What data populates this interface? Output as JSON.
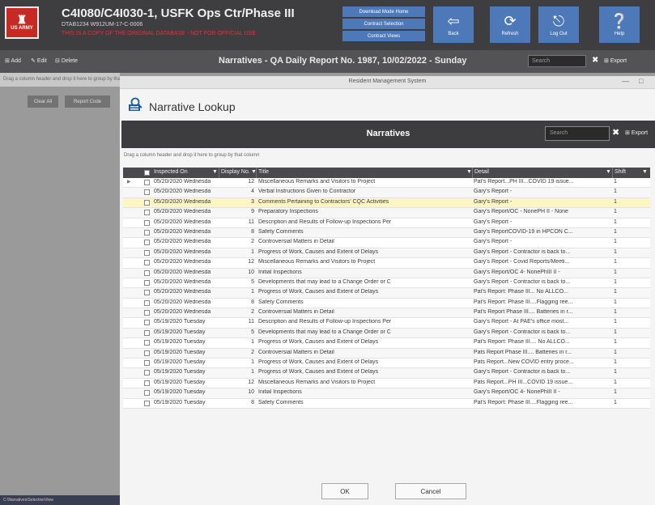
{
  "app": {
    "logo_text": "US ARMY",
    "project_title": "C4I080/C4I030-1, USFK Ops Ctr/Phase III",
    "project_subtitle": "DTAB1234 W912UM-17-C-0006",
    "project_note": "THIS IS A COPY OF THE ORIGINAL DATABASE - NOT FOR OFFICIAL USE",
    "stack_buttons": [
      "Download Mode Home",
      "Contract Selection",
      "Contract Views"
    ],
    "buttons": [
      {
        "label": "Back",
        "icon": "back-arrow-icon"
      },
      {
        "label": "Refresh",
        "icon": "refresh-icon"
      },
      {
        "label": "Log Out",
        "icon": "logout-icon"
      },
      {
        "label": "Help",
        "icon": "help-icon"
      }
    ]
  },
  "toolbar": {
    "add_label": "Add",
    "edit_label": "Edit",
    "delete_label": "Delete",
    "title": "Narratives - QA Daily Report No. 1987, 10/02/2022 - Sunday",
    "search_placeholder": "Search",
    "export_label": "Export"
  },
  "background": {
    "group_hint": "Drag a column header and drop it here to group by that column",
    "btn1": "Clear All",
    "btn2": "Report Code",
    "status": "C:\\Narratives\\SelectionView"
  },
  "dialog": {
    "window_title": "Resident Management System",
    "heading": "Narrative Lookup",
    "panel_title": "Narratives",
    "search_placeholder": "Search",
    "export_label": "Export",
    "group_hint": "Drag a column header and drop it here to group by that column",
    "columns": {
      "date": "Inspected On",
      "no": "Display No.",
      "title": "Title",
      "detail": "Detail",
      "shift": "Shift"
    },
    "rows": [
      {
        "date": "05/20/2020 Wednesda",
        "no": "12",
        "title": "Miscellaneous Remarks and Visitors to Project",
        "detail": "Pat's Report...PH III...COVID 19 issue...",
        "shift": "1"
      },
      {
        "date": "05/20/2020 Wednesda",
        "no": "4",
        "title": "Verbal Instructions Given to Contractor",
        "detail": "Gary's Report -",
        "shift": "1"
      },
      {
        "date": "05/20/2020 Wednesda",
        "no": "3",
        "title": "Comments Pertaining to Contractors' CQC Activities",
        "detail": "Gary's Report -",
        "shift": "1"
      },
      {
        "date": "05/20/2020 Wednesda",
        "no": "9",
        "title": "Preparatory Inspections",
        "detail": "Gary's Report/OC - NonePH II - None",
        "shift": "1"
      },
      {
        "date": "05/20/2020 Wednesda",
        "no": "11",
        "title": "Description and Results of Follow-up Inspections Per",
        "detail": "Gary's Report -",
        "shift": "1"
      },
      {
        "date": "05/20/2020 Wednesda",
        "no": "8",
        "title": "Safety Comments",
        "detail": "Gary's ReportCOVID-19 in HPCON C...",
        "shift": "1"
      },
      {
        "date": "05/20/2020 Wednesda",
        "no": "2",
        "title": "Controversial Matters in Detail",
        "detail": "Gary's Report -",
        "shift": "1"
      },
      {
        "date": "05/20/2020 Wednesda",
        "no": "1",
        "title": "Progress of Work, Causes and Extent of Delays",
        "detail": "Gary's Report - Contractor is back to...",
        "shift": "1"
      },
      {
        "date": "05/20/2020 Wednesda",
        "no": "12",
        "title": "Miscellaneous Remarks and Visitors to Project",
        "detail": "Gary's Report - Covid Reports/Meeti...",
        "shift": "1"
      },
      {
        "date": "05/20/2020 Wednesda",
        "no": "10",
        "title": "Initial Inspections",
        "detail": "Gary's Report/OC 4- NonePhIII II -",
        "shift": "1"
      },
      {
        "date": "05/20/2020 Wednesda",
        "no": "5",
        "title": "Developments that may lead to a Change Order or C",
        "detail": "Gary's Report - Contractor is back to...",
        "shift": "1"
      },
      {
        "date": "05/20/2020 Wednesda",
        "no": "1",
        "title": "Progress of Work, Causes and Extent of Delays",
        "detail": "Pat's Report: Phase III... No ALLCO...",
        "shift": "1"
      },
      {
        "date": "05/20/2020 Wednesda",
        "no": "8",
        "title": "Safety Comments",
        "detail": "Pat's Report: Phase III....Flagging ree...",
        "shift": "1"
      },
      {
        "date": "05/20/2020 Wednesda",
        "no": "2",
        "title": "Controversial Matters in Detail",
        "detail": "Pat's Report Phase III.... Batteries in r...",
        "shift": "1"
      },
      {
        "date": "05/19/2020 Tuesday",
        "no": "11",
        "title": "Description and Results of Follow-up Inspections Per",
        "detail": "Gary's Report - At PAE's office most...",
        "shift": "1"
      },
      {
        "date": "05/19/2020 Tuesday",
        "no": "5",
        "title": "Developments that may lead to a Change Order or C",
        "detail": "Gary's Report - Contractor is back to...",
        "shift": "1"
      },
      {
        "date": "05/19/2020 Tuesday",
        "no": "1",
        "title": "Progress of Work, Causes and Extent of Delays",
        "detail": "Pat's Report: Phase III.... No ALLCO...",
        "shift": "1"
      },
      {
        "date": "05/19/2020 Tuesday",
        "no": "2",
        "title": "Controversial Matters in Detail",
        "detail": "Pats Report Phase III.... Batteries in r...",
        "shift": "1"
      },
      {
        "date": "05/19/2020 Tuesday",
        "no": "1",
        "title": "Progress of Work, Causes and Extent of Delays",
        "detail": "Pats Report...New COVID entry proce...",
        "shift": "1"
      },
      {
        "date": "05/19/2020 Tuesday",
        "no": "1",
        "title": "Progress of Work, Causes and Extent of Delays",
        "detail": "Gary's Report - Contractor is back to...",
        "shift": "1"
      },
      {
        "date": "05/19/2020 Tuesday",
        "no": "12",
        "title": "Miscellaneous Remarks and Visitors to Project",
        "detail": "Pats Report...PH III...COVID 19 issue...",
        "shift": "1"
      },
      {
        "date": "05/19/2020 Tuesday",
        "no": "10",
        "title": "Initial Inspections",
        "detail": "Gary's Report/OC 4- NonePhIII II -",
        "shift": "1"
      },
      {
        "date": "05/19/2020 Tuesday",
        "no": "8",
        "title": "Safety Comments",
        "detail": "Pat's Report: Phase III....Flagging ree...",
        "shift": "1"
      }
    ],
    "selected_row": 2,
    "ok_label": "OK",
    "cancel_label": "Cancel"
  },
  "colors": {
    "header_bg": "#3e3e40",
    "accent_blue": "#4d79b8",
    "selected_row": "#fdf6c2",
    "note_red": "#d23a3a"
  }
}
